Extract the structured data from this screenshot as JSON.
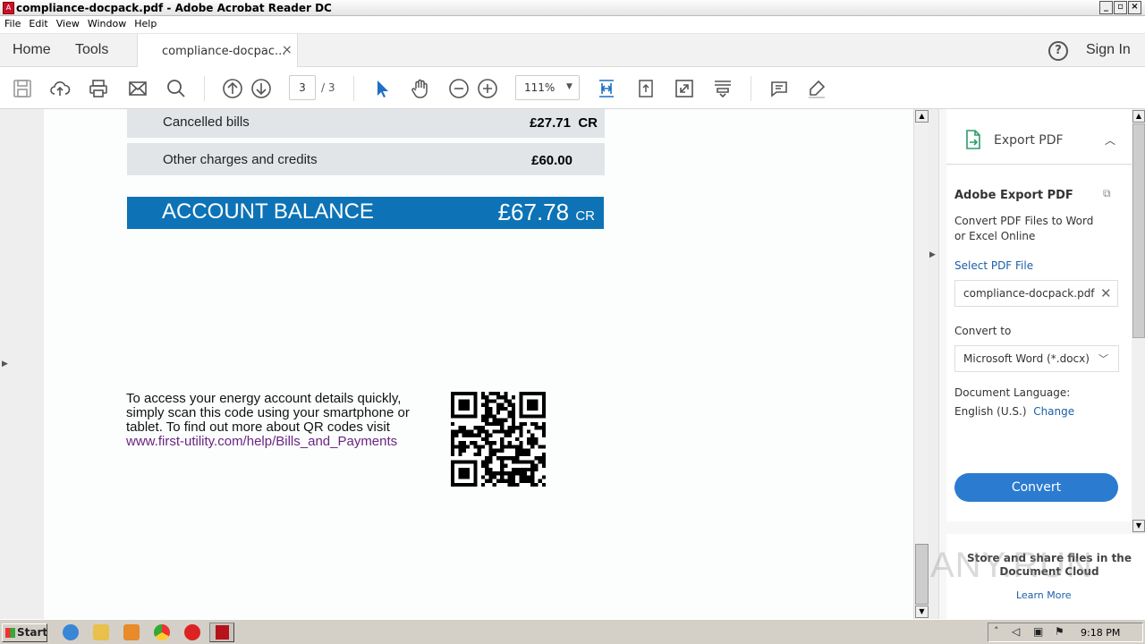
{
  "window": {
    "title": "compliance-docpack.pdf - Adobe Acrobat Reader DC"
  },
  "menu": [
    "File",
    "Edit",
    "View",
    "Window",
    "Help"
  ],
  "tabs": {
    "home": "Home",
    "tools": "Tools",
    "document": "compliance-docpac...",
    "close": "×"
  },
  "header": {
    "signin": "Sign In",
    "help": "?"
  },
  "toolbar": {
    "page_current": "3",
    "page_total": "/ 3",
    "zoom": "111%"
  },
  "document": {
    "rows": [
      {
        "label": "Cancelled bills",
        "amount": "£27.71",
        "suffix": "CR"
      },
      {
        "label": "Other charges and credits",
        "amount": "£60.00",
        "suffix": ""
      }
    ],
    "balance": {
      "label": "ACCOUNT BALANCE",
      "amount": "£67.78",
      "suffix": "CR"
    },
    "qr_text": "To access your energy account details quickly, simply scan this code using your smartphone or tablet. To find out more about QR codes visit",
    "qr_link": "www.first-utility.com/help/Bills_and_Payments"
  },
  "panel": {
    "header": "Export PDF",
    "title": "Adobe Export PDF",
    "description_1": "Convert PDF Files to Word",
    "description_2": "or Excel Online",
    "select_link": "Select PDF File",
    "file_name": "compliance-docpack.pdf",
    "convert_to_label": "Convert to",
    "convert_to_value": "Microsoft Word (*.docx)",
    "language_label": "Document Language:",
    "language_value": "English (U.S.)",
    "change_link": "Change",
    "convert_button": "Convert",
    "footer_text": "Store and share files in the Document Cloud",
    "learn_more": "Learn More"
  },
  "watermark": "ANY.RUN",
  "taskbar": {
    "start": "Start",
    "clock": "9:18 PM"
  }
}
